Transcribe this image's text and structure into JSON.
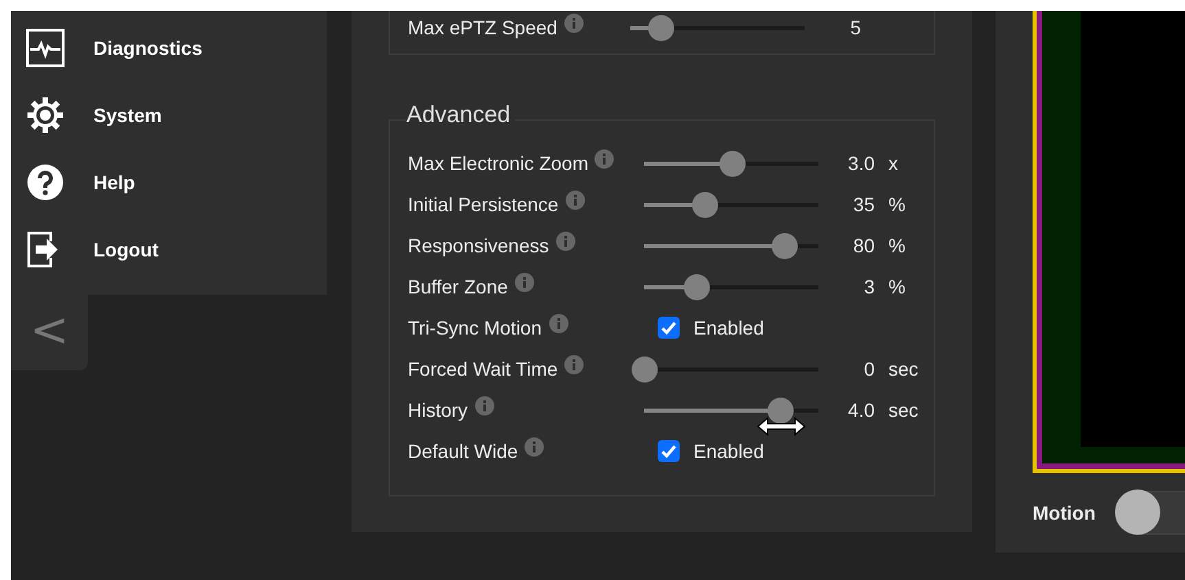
{
  "sidebar": {
    "items": [
      {
        "label": "Diagnostics"
      },
      {
        "label": "System"
      },
      {
        "label": "Help"
      },
      {
        "label": "Logout"
      }
    ],
    "collapse_button": "<"
  },
  "top_section": {
    "rows": [
      {
        "kind": "slider",
        "label": "Max ePTZ Speed",
        "level": 0.17,
        "value": "5"
      }
    ]
  },
  "advanced": {
    "title": "Advanced",
    "rows": [
      {
        "kind": "slider",
        "label": "Max Electronic Zoom",
        "level": 0.5,
        "value": "3.0",
        "unit": "x"
      },
      {
        "kind": "slider",
        "label": "Initial Persistence",
        "level": 0.35,
        "value": "35",
        "unit": "%"
      },
      {
        "kind": "slider",
        "label": "Responsiveness",
        "level": 0.8,
        "value": "80",
        "unit": "%"
      },
      {
        "kind": "slider",
        "label": "Buffer Zone",
        "level": 0.3,
        "value": "3",
        "unit": "%"
      },
      {
        "kind": "checkbox",
        "label": "Tri-Sync Motion",
        "checked": true,
        "text": "Enabled"
      },
      {
        "kind": "slider",
        "label": "Forced Wait Time",
        "level": 0,
        "value": "0",
        "unit": "sec"
      },
      {
        "kind": "slider",
        "label": "History",
        "level": 0.78,
        "value": "4.0",
        "unit": "sec"
      },
      {
        "kind": "checkbox",
        "label": "Default Wide",
        "checked": true,
        "text": "Enabled"
      }
    ]
  },
  "preview": {
    "toggle_label": "Motion",
    "toggle_on": false
  }
}
